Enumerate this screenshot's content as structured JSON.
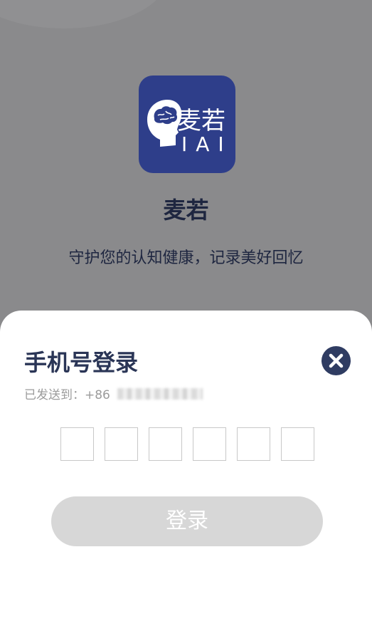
{
  "app": {
    "logo_brand": "麦若",
    "logo_sub": "IAI",
    "name": "麦若",
    "slogan": "守护您的认知健康，记录美好回忆"
  },
  "login_sheet": {
    "title": "手机号登录",
    "sent_label": "已发送到：+86",
    "code_box_count": 6,
    "login_button_label": "登录",
    "close_icon": "close-circle-icon"
  },
  "colors": {
    "overlay_bg": "#8a8a8c",
    "logo_bg": "#2e3e8a",
    "title_text": "#2a3556",
    "close_bg": "#2f3c62",
    "button_disabled": "#d7d7d7"
  }
}
